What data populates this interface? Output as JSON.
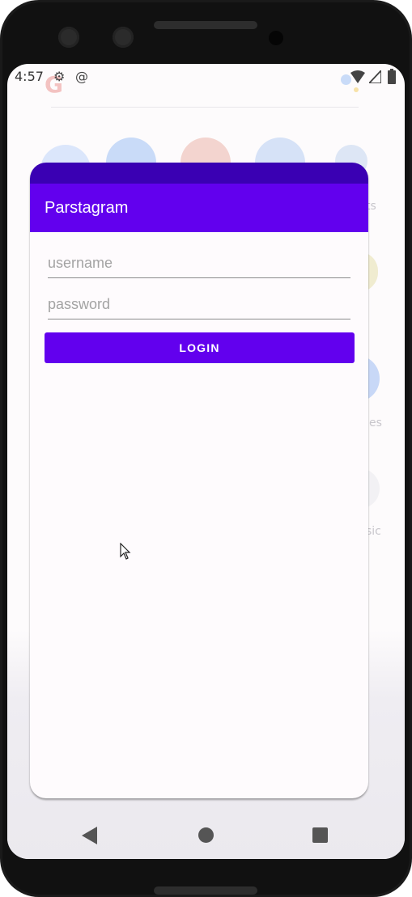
{
  "status_bar": {
    "time": "4:57",
    "icons": [
      "gear-icon",
      "at-sign-icon",
      "assistant-icon",
      "wifi-icon",
      "signal-icon",
      "battery-icon"
    ]
  },
  "launcher": {
    "faint_labels": [
      "ts",
      "es",
      "sic"
    ]
  },
  "app": {
    "title": "Parstagram",
    "username_placeholder": "username",
    "password_placeholder": "password",
    "login_label": "LOGIN"
  },
  "colors": {
    "primary": "#6200ee",
    "primary_dark": "#3a00b3",
    "background": "#fefbfd"
  }
}
